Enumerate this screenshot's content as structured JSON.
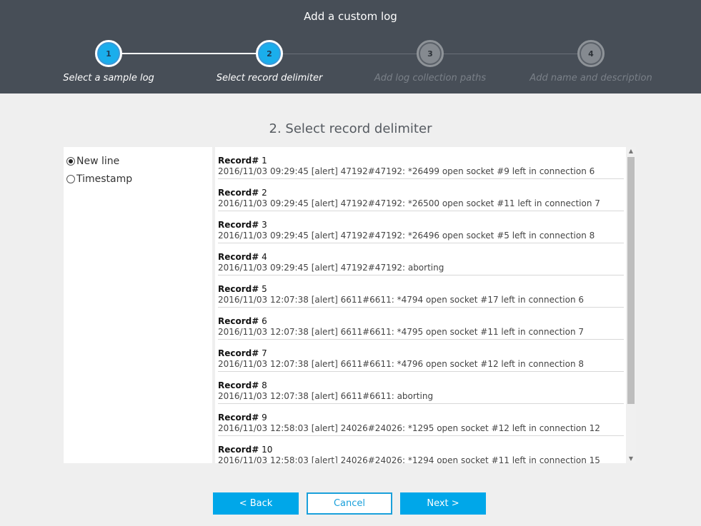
{
  "header": {
    "title": "Add a custom log"
  },
  "steps": [
    {
      "num": "1",
      "label": "Select a sample log"
    },
    {
      "num": "2",
      "label": "Select record delimiter"
    },
    {
      "num": "3",
      "label": "Add log collection paths"
    },
    {
      "num": "4",
      "label": "Add name and description"
    }
  ],
  "section_title": "2. Select record delimiter",
  "options": [
    {
      "label": "New line",
      "checked": true
    },
    {
      "label": "Timestamp",
      "checked": false
    }
  ],
  "record_prefix": "Record#",
  "records": [
    {
      "num": "1",
      "text": "2016/11/03 09:29:45 [alert] 47192#47192: *26499 open socket #9 left in connection 6"
    },
    {
      "num": "2",
      "text": "2016/11/03 09:29:45 [alert] 47192#47192: *26500 open socket #11 left in connection 7"
    },
    {
      "num": "3",
      "text": "2016/11/03 09:29:45 [alert] 47192#47192: *26496 open socket #5 left in connection 8"
    },
    {
      "num": "4",
      "text": "2016/11/03 09:29:45 [alert] 47192#47192: aborting"
    },
    {
      "num": "5",
      "text": "2016/11/03 12:07:38 [alert] 6611#6611: *4794 open socket #17 left in connection 6"
    },
    {
      "num": "6",
      "text": "2016/11/03 12:07:38 [alert] 6611#6611: *4795 open socket #11 left in connection 7"
    },
    {
      "num": "7",
      "text": "2016/11/03 12:07:38 [alert] 6611#6611: *4796 open socket #12 left in connection 8"
    },
    {
      "num": "8",
      "text": "2016/11/03 12:07:38 [alert] 6611#6611: aborting"
    },
    {
      "num": "9",
      "text": "2016/11/03 12:58:03 [alert] 24026#24026: *1295 open socket #12 left in connection 12"
    },
    {
      "num": "10",
      "text": "2016/11/03 12:58:03 [alert] 24026#24026: *1294 open socket #11 left in connection 15"
    }
  ],
  "buttons": {
    "back": "< Back",
    "cancel": "Cancel",
    "next": "Next >"
  },
  "colors": {
    "header_bg": "#474e57",
    "accent": "#00a7e9",
    "step_active": "#1aaeec"
  }
}
